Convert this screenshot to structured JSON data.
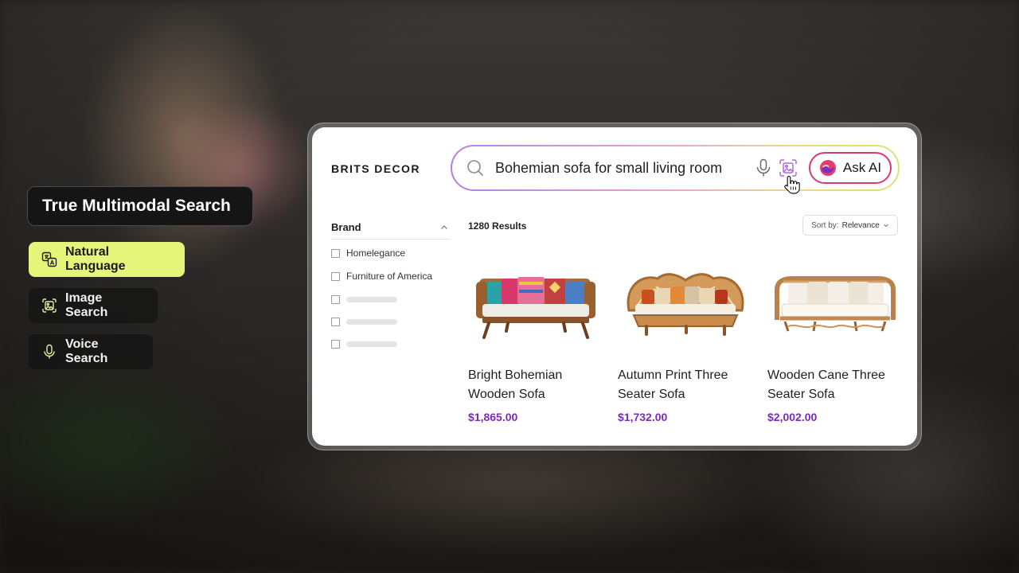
{
  "sidebar": {
    "title": "True Multimodal Search",
    "features": [
      {
        "label": "Natural Language",
        "icon": "translate-icon"
      },
      {
        "label": "Image Search",
        "icon": "image-search-icon"
      },
      {
        "label": "Voice Search",
        "icon": "microphone-icon"
      }
    ]
  },
  "store": {
    "brand": "BRITS DECOR",
    "search": {
      "value": "Bohemian sofa for small living room",
      "ask_ai_label": "Ask AI"
    },
    "filters": {
      "heading": "Brand",
      "items": [
        "Homelegance",
        "Furniture of America"
      ]
    },
    "results": {
      "count": "1280 Results",
      "sort_label": "Sort by:",
      "sort_value": "Relevance"
    },
    "products": [
      {
        "name": "Bright Bohemian Wooden Sofa",
        "price": "$1,865.00"
      },
      {
        "name": "Autumn Print Three Seater Sofa",
        "price": "$1,732.00"
      },
      {
        "name": "Wooden Cane Three Seater Sofa",
        "price": "$2,002.00"
      }
    ]
  },
  "colors": {
    "accent_lime": "#e4f57a",
    "price_purple": "#7a2bb8",
    "ask_ai_border": "#d63a74"
  }
}
